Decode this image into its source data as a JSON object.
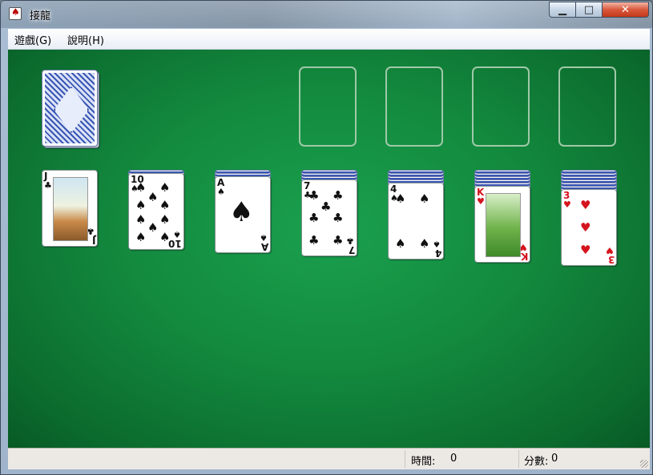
{
  "window": {
    "title": "接龍",
    "controls": {
      "minimize": "▁",
      "maximize": "□",
      "close": "✕"
    }
  },
  "menu": {
    "items": [
      {
        "label": "遊戲(G)"
      },
      {
        "label": "說明(H)"
      }
    ]
  },
  "game": {
    "stock": {
      "face_down_count": 1
    },
    "foundations": 4,
    "tableau": [
      {
        "face_down": 0,
        "rank": "J",
        "suit": "♣",
        "color": "blk"
      },
      {
        "face_down": 1,
        "rank": "10",
        "suit": "♠",
        "color": "blk"
      },
      {
        "face_down": 2,
        "rank": "A",
        "suit": "♠",
        "color": "blk"
      },
      {
        "face_down": 3,
        "rank": "7",
        "suit": "♣",
        "color": "blk"
      },
      {
        "face_down": 4,
        "rank": "4",
        "suit": "♠",
        "color": "blk"
      },
      {
        "face_down": 5,
        "rank": "K",
        "suit": "♥",
        "color": "red"
      },
      {
        "face_down": 6,
        "rank": "3",
        "suit": "♥",
        "color": "red"
      }
    ]
  },
  "status": {
    "time_label": "時間:",
    "time_value": "0",
    "score_label": "分數:",
    "score_value": "0"
  },
  "colors": {
    "felt": "#138a3e",
    "card_back": "#3b56b4",
    "red_suit": "#d4141e"
  }
}
